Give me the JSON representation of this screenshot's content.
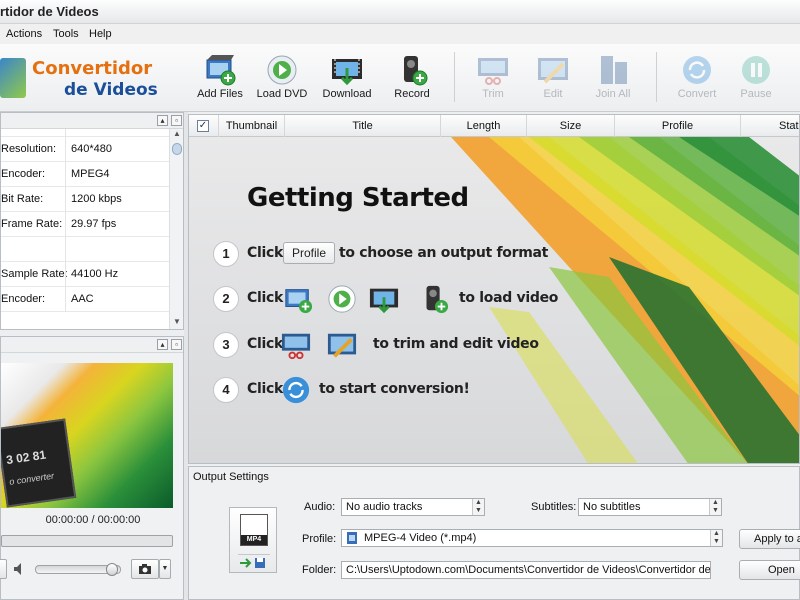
{
  "window": {
    "title": "rtidor de Videos"
  },
  "menu": {
    "items": [
      "Actions",
      "Tools",
      "Help"
    ]
  },
  "logo": {
    "line1": "Convertidor",
    "line2": "de Videos"
  },
  "toolbar": {
    "buttons": [
      {
        "label": "Add Files",
        "icon": "add-files-icon",
        "enabled": true
      },
      {
        "label": "Load DVD",
        "icon": "load-dvd-icon",
        "enabled": true
      },
      {
        "label": "Download",
        "icon": "download-icon",
        "enabled": true
      },
      {
        "label": "Record",
        "icon": "record-icon",
        "enabled": true
      },
      {
        "label": "Trim",
        "icon": "trim-icon",
        "enabled": false
      },
      {
        "label": "Edit",
        "icon": "edit-icon",
        "enabled": false
      },
      {
        "label": "Join All",
        "icon": "join-all-icon",
        "enabled": false
      },
      {
        "label": "Convert",
        "icon": "convert-icon",
        "enabled": false
      },
      {
        "label": "Pause",
        "icon": "pause-icon",
        "enabled": false
      }
    ]
  },
  "properties": {
    "rows": [
      {
        "key": "",
        "value": ""
      },
      {
        "key": "Resolution:",
        "value": "640*480"
      },
      {
        "key": "Encoder:",
        "value": "MPEG4"
      },
      {
        "key": "Bit Rate:",
        "value": "1200 kbps"
      },
      {
        "key": "Frame Rate:",
        "value": "29.97 fps"
      },
      {
        "key": "",
        "value": ""
      },
      {
        "key": "Sample Rate:",
        "value": "44100 Hz"
      },
      {
        "key": "Encoder:",
        "value": "AAC"
      }
    ]
  },
  "preview": {
    "time": "00:00:00 / 00:00:00",
    "clapper_text": "3 02 81",
    "clapper_caption": "o converter"
  },
  "filelist": {
    "columns": [
      "Thumbnail",
      "Title",
      "Length",
      "Size",
      "Profile",
      "Statu"
    ]
  },
  "getting_started": {
    "title": "Getting Started",
    "steps": [
      {
        "num": "1",
        "click": "Click",
        "button": "Profile",
        "text": "to choose an output format"
      },
      {
        "num": "2",
        "click": "Click",
        "text": "to load video"
      },
      {
        "num": "3",
        "click": "Click",
        "text": "to trim and edit video"
      },
      {
        "num": "4",
        "click": "Click",
        "text": "to start conversion!"
      }
    ]
  },
  "output": {
    "title": "Output Settings",
    "format_tag": "MP4",
    "audio_label": "Audio:",
    "audio_value": "No audio tracks",
    "subtitles_label": "Subtitles:",
    "subtitles_value": "No subtitles",
    "profile_label": "Profile:",
    "profile_value": "MPEG-4 Video (*.mp4)",
    "folder_label": "Folder:",
    "folder_value": "C:\\Users\\Uptodown.com\\Documents\\Convertidor de Videos\\Convertidor de V",
    "apply_label": "Apply to a",
    "open_label": "Open"
  },
  "colors": {
    "accent_orange": "#e57010",
    "accent_blue": "#1b4f9a",
    "green": "#8cc63f"
  }
}
